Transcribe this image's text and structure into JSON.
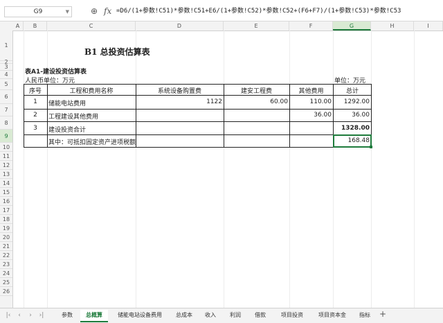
{
  "formula_bar": {
    "name_box": "G9",
    "formula": "=D6/(1+参数!C51)*参数!C51+E6/(1+参数!C52)*参数!C52+(F6+F7)/(1+参数!C53)*参数!C53"
  },
  "columns": [
    "A",
    "B",
    "C",
    "D",
    "E",
    "F",
    "G",
    "H",
    "I"
  ],
  "rows": [
    "1",
    "2",
    "3",
    "4",
    "5",
    "6",
    "7",
    "8",
    "9",
    "10",
    "11",
    "12",
    "13",
    "14",
    "15",
    "16",
    "17",
    "18",
    "19",
    "20",
    "21",
    "22",
    "23",
    "24",
    "25",
    "26"
  ],
  "sheet": {
    "title": "B1 总投资估算表",
    "subtitle": "表A1-建设投资估算表",
    "currency_left": "人民币单位：万元",
    "currency_right": "单位：万元",
    "headers": [
      "序号",
      "工程和费用名称",
      "系统设备购置费",
      "建安工程费",
      "其他费用",
      "总计"
    ],
    "rows": [
      {
        "no": "1",
        "name": "储能电站费用",
        "equip": "1122",
        "build": "60.00",
        "other": "110.00",
        "total": "1292.00"
      },
      {
        "no": "2",
        "name": "工程建设其他费用",
        "equip": "",
        "build": "",
        "other": "36.00",
        "total": "36.00"
      },
      {
        "no": "3",
        "name": "建设投资合计",
        "equip": "",
        "build": "",
        "other": "",
        "total": "1328.00"
      },
      {
        "no": "",
        "name": "其中：可抵扣固定资产进项税额",
        "equip": "",
        "build": "",
        "other": "",
        "total": "168.48"
      }
    ]
  },
  "tabs": [
    "参数",
    "总概算",
    "储能电站设备费用",
    "总成本",
    "收入",
    "利润",
    "借款",
    "项目投资",
    "项目资本金",
    "指标"
  ],
  "active_tab": "总概算",
  "colors": {
    "accent": "#1e7b3c"
  }
}
